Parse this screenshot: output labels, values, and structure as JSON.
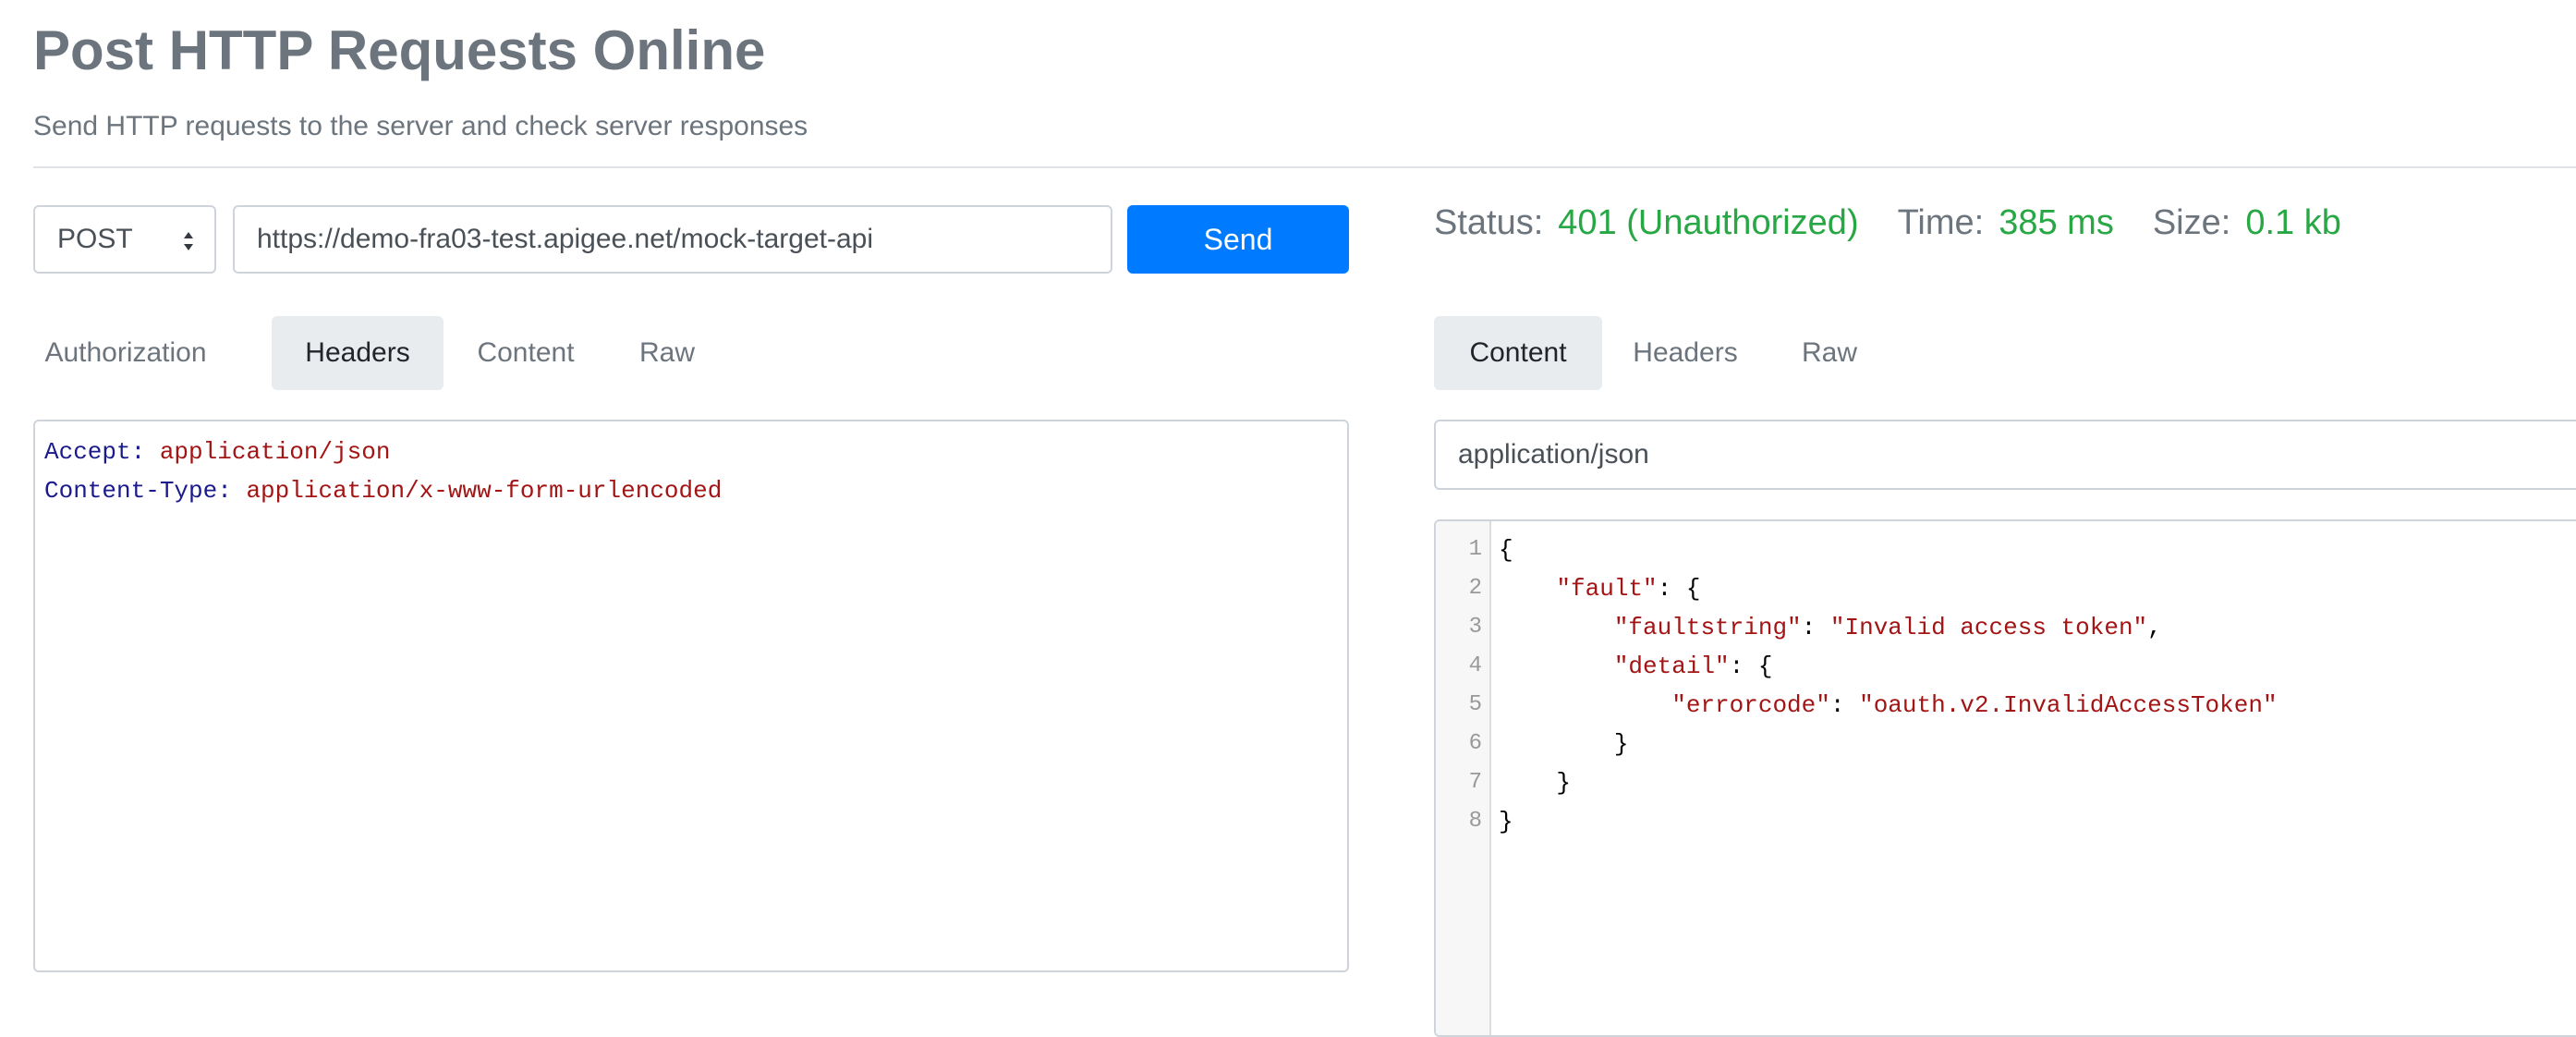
{
  "page": {
    "title": "Post HTTP Requests Online",
    "subtitle": "Send HTTP requests to the server and check server responses"
  },
  "request": {
    "method": "POST",
    "url": "https://demo-fra03-test.apigee.net/mock-target-api",
    "send_label": "Send",
    "tabs": [
      {
        "label": "Authorization",
        "active": false
      },
      {
        "label": "Headers",
        "active": true
      },
      {
        "label": "Content",
        "active": false
      },
      {
        "label": "Raw",
        "active": false
      }
    ],
    "headers": [
      {
        "key": "Accept:",
        "value": "application/json"
      },
      {
        "key": "Content-Type:",
        "value": "application/x-www-form-urlencoded"
      }
    ]
  },
  "response": {
    "status_label": "Status:",
    "status_value": "401 (Unauthorized)",
    "time_label": "Time:",
    "time_value": "385 ms",
    "size_label": "Size:",
    "size_value": "0.1 kb",
    "tabs": [
      {
        "label": "Content",
        "active": true
      },
      {
        "label": "Headers",
        "active": false
      },
      {
        "label": "Raw",
        "active": false
      }
    ],
    "content_type": "application/json",
    "body_lines": [
      {
        "num": "1",
        "indent": "",
        "key": "",
        "sep": "",
        "val": "",
        "punct": "{"
      },
      {
        "num": "2",
        "indent": "    ",
        "key": "\"fault\"",
        "sep": ": ",
        "val": "",
        "punct": "{"
      },
      {
        "num": "3",
        "indent": "        ",
        "key": "\"faultstring\"",
        "sep": ": ",
        "val": "\"Invalid access token\"",
        "punct": ","
      },
      {
        "num": "4",
        "indent": "        ",
        "key": "\"detail\"",
        "sep": ": ",
        "val": "",
        "punct": "{"
      },
      {
        "num": "5",
        "indent": "            ",
        "key": "\"errorcode\"",
        "sep": ": ",
        "val": "\"oauth.v2.InvalidAccessToken\"",
        "punct": ""
      },
      {
        "num": "6",
        "indent": "        ",
        "key": "",
        "sep": "",
        "val": "",
        "punct": "}"
      },
      {
        "num": "7",
        "indent": "    ",
        "key": "",
        "sep": "",
        "val": "",
        "punct": "}"
      },
      {
        "num": "8",
        "indent": "",
        "key": "",
        "sep": "",
        "val": "",
        "punct": "}"
      }
    ]
  },
  "colors": {
    "accent": "#007bff",
    "success": "#28a745",
    "muted": "#6c757d",
    "code_key": "#a31515",
    "header_key": "#1a1a8c"
  }
}
